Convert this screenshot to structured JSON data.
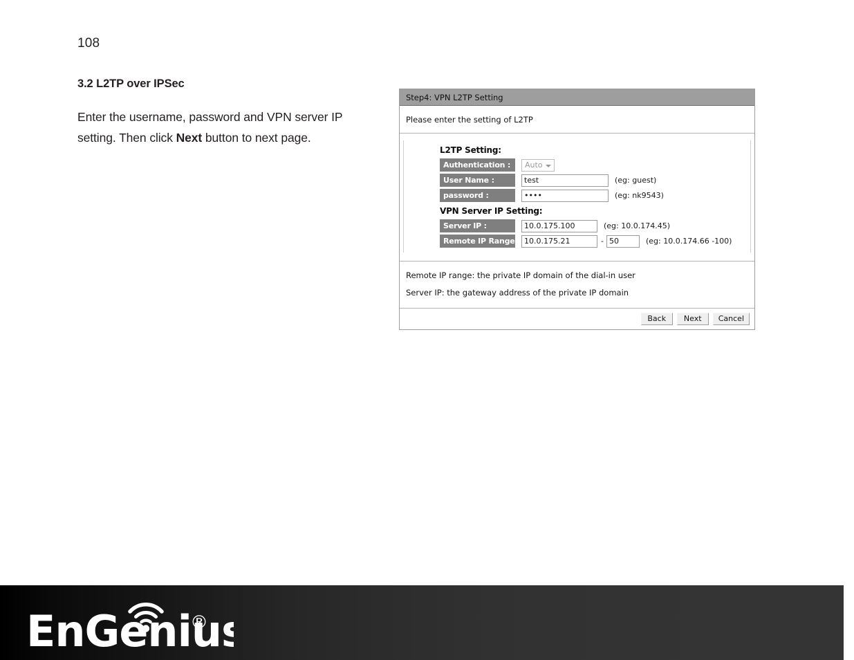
{
  "page": {
    "number": "108"
  },
  "document": {
    "section_heading": "3.2 L2TP over IPSec",
    "paragraph_part1": "Enter the username, password and VPN server IP setting. Then click ",
    "paragraph_bold": "Next",
    "paragraph_part2": " button to next page."
  },
  "dialog": {
    "title": "Step4: VPN L2TP Setting",
    "instruction": "Please enter the setting of L2TP",
    "groups": [
      {
        "title": "L2TP Setting:",
        "rows": [
          {
            "label": "Authentication :",
            "control": "select",
            "value": "Auto",
            "hint": ""
          },
          {
            "label": "User Name :",
            "control": "text",
            "value": "test",
            "placeholder": "",
            "hint": "(eg: guest)"
          },
          {
            "label": "password :",
            "control": "password",
            "value": "••••",
            "placeholder": "",
            "hint": "(eg: nk9543)"
          }
        ]
      },
      {
        "title": "VPN Server IP Setting:",
        "rows": [
          {
            "label": "Server IP :",
            "control": "text",
            "value": "10.0.175.100",
            "placeholder": "",
            "hint": "(eg: 10.0.174.45)"
          },
          {
            "label": "Remote IP Range :",
            "control": "range",
            "value": "10.0.175.21",
            "value2": "50",
            "separator": "-",
            "placeholder": "",
            "hint": "(eg: 10.0.174.66 -100)"
          }
        ]
      }
    ],
    "notes": [
      "Remote IP range: the private IP domain of the dial-in user",
      "Server IP: the gateway address of the private IP domain"
    ],
    "buttons": {
      "back": "Back",
      "next": "Next",
      "cancel": "Cancel"
    },
    "colors": {
      "titlebar": "#9e9e9e",
      "row_label_bg": "#7f7f7f",
      "border": "#9c9c9c"
    }
  },
  "footer": {
    "brand": "EnGenius",
    "registered_mark": "®",
    "band_color_left": "#000000",
    "band_color_right": "#343434"
  }
}
